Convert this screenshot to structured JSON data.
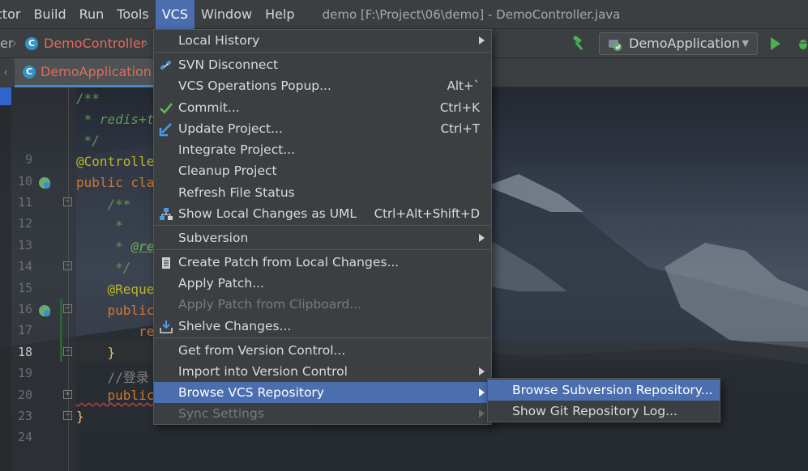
{
  "menubar": {
    "items": [
      {
        "label": "ctor"
      },
      {
        "label": "Build"
      },
      {
        "label": "Run"
      },
      {
        "label": "Tools"
      },
      {
        "label": "VCS"
      },
      {
        "label": "Window"
      },
      {
        "label": "Help"
      }
    ],
    "active_item": "VCS",
    "window_title": "demo [F:\\Project\\06\\demo] - DemoController.java"
  },
  "navbar": {
    "breadcrumb_prev": "er",
    "breadcrumb_current": "DemoController",
    "class_icon_letter": "C",
    "run_config": "DemoApplication"
  },
  "tabs": {
    "active_label": "DemoApplication.ja",
    "active_icon_letter": "C"
  },
  "editor": {
    "line_numbers": [
      "9",
      "10",
      "11",
      "12",
      "13",
      "14",
      "15",
      "16",
      "17",
      "18",
      "19",
      "20",
      "23",
      "24"
    ],
    "current_line": "18",
    "code_lines": {
      "l1": "/**",
      "l2": " * redis+t",
      "l3": " */",
      "l4": "@Controlle",
      "l5_kw": "public cla",
      "l6": "    /**",
      "l7": "     *",
      "l8_star": "     * ",
      "l8_tag": "@re",
      "l9": "     */",
      "l10": "    @Reque",
      "l11": "    public",
      "l12": "        re",
      "l13": "    }",
      "l14": "    //登录",
      "l15": "    public",
      "l16": "}"
    }
  },
  "vcs_menu": {
    "items": [
      {
        "label": "Local History",
        "mnemonic": "H",
        "shortcut": "",
        "submenu": true
      },
      {
        "label": "SVN Disconnect",
        "icon": "svn-disconnect-icon",
        "shortcut": ""
      },
      {
        "label": "VCS Operations Popup...",
        "shortcut": "Alt+`"
      },
      {
        "label": "Commit...",
        "icon": "checkmark-icon",
        "shortcut": "Ctrl+K"
      },
      {
        "label": "Update Project...",
        "icon": "update-arrow-icon",
        "shortcut": "Ctrl+T"
      },
      {
        "label": "Integrate Project...",
        "shortcut": ""
      },
      {
        "label": "Cleanup Project",
        "shortcut": ""
      },
      {
        "label": "Refresh File Status",
        "shortcut": ""
      },
      {
        "label": "Show Local Changes as UML",
        "icon": "uml-diagram-icon",
        "shortcut": "Ctrl+Alt+Shift+D"
      },
      {
        "label": "Subversion",
        "shortcut": "",
        "submenu": true
      },
      {
        "label": "Create Patch from Local Changes...",
        "icon": "patch-icon",
        "shortcut": ""
      },
      {
        "label": "Apply Patch...",
        "shortcut": ""
      },
      {
        "label": "Apply Patch from Clipboard...",
        "shortcut": "",
        "disabled": true
      },
      {
        "label": "Shelve Changes...",
        "icon": "shelve-icon",
        "shortcut": ""
      },
      {
        "label": "Get from Version Control...",
        "shortcut": ""
      },
      {
        "label": "Import into Version Control",
        "shortcut": "",
        "submenu": true
      },
      {
        "label": "Browse VCS Repository",
        "shortcut": "",
        "submenu": true,
        "selected": true
      },
      {
        "label": "Sync Settings",
        "shortcut": "",
        "submenu": true,
        "disabled": true
      }
    ]
  },
  "browse_submenu": {
    "items": [
      {
        "label": "Browse Subversion Repository...",
        "selected": true
      },
      {
        "label": "Show Git Repository Log..."
      }
    ]
  },
  "colors": {
    "selection": "#4b6eaf",
    "menu_bg": "#3c3f41",
    "comment": "#629755",
    "keyword": "#cc7832",
    "annotation": "#bbb529",
    "error_file": "#e06c5a"
  }
}
